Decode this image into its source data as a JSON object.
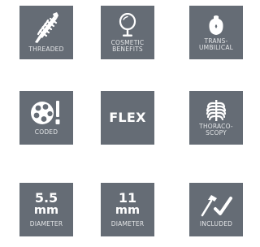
{
  "colors": {
    "tile_bg": "#656c75",
    "icon": "#ffffff",
    "label": "#e3e5e7"
  },
  "tiles": [
    {
      "icon": "threaded-shaft-icon",
      "label": "THREADED"
    },
    {
      "icon": "mirror-icon",
      "label_line1": "COSMETIC",
      "label_line2": "BENEFITS"
    },
    {
      "icon": "umbilicus-icon",
      "label_line1": "TRANS-",
      "label_line2": "UMBILICAL"
    },
    {
      "icon": "color-palette-icon",
      "label": "CODED"
    },
    {
      "text": "FLEX"
    },
    {
      "icon": "ribcage-icon",
      "label_line1": "THORACO-",
      "label_line2": "SCOPY"
    },
    {
      "number": "5.5",
      "unit": "mm",
      "label": "DIAMETER"
    },
    {
      "number": "11",
      "unit": "mm",
      "label": "DIAMETER"
    },
    {
      "icon": "hammer-check-icon",
      "label": "INCLUDED"
    }
  ]
}
